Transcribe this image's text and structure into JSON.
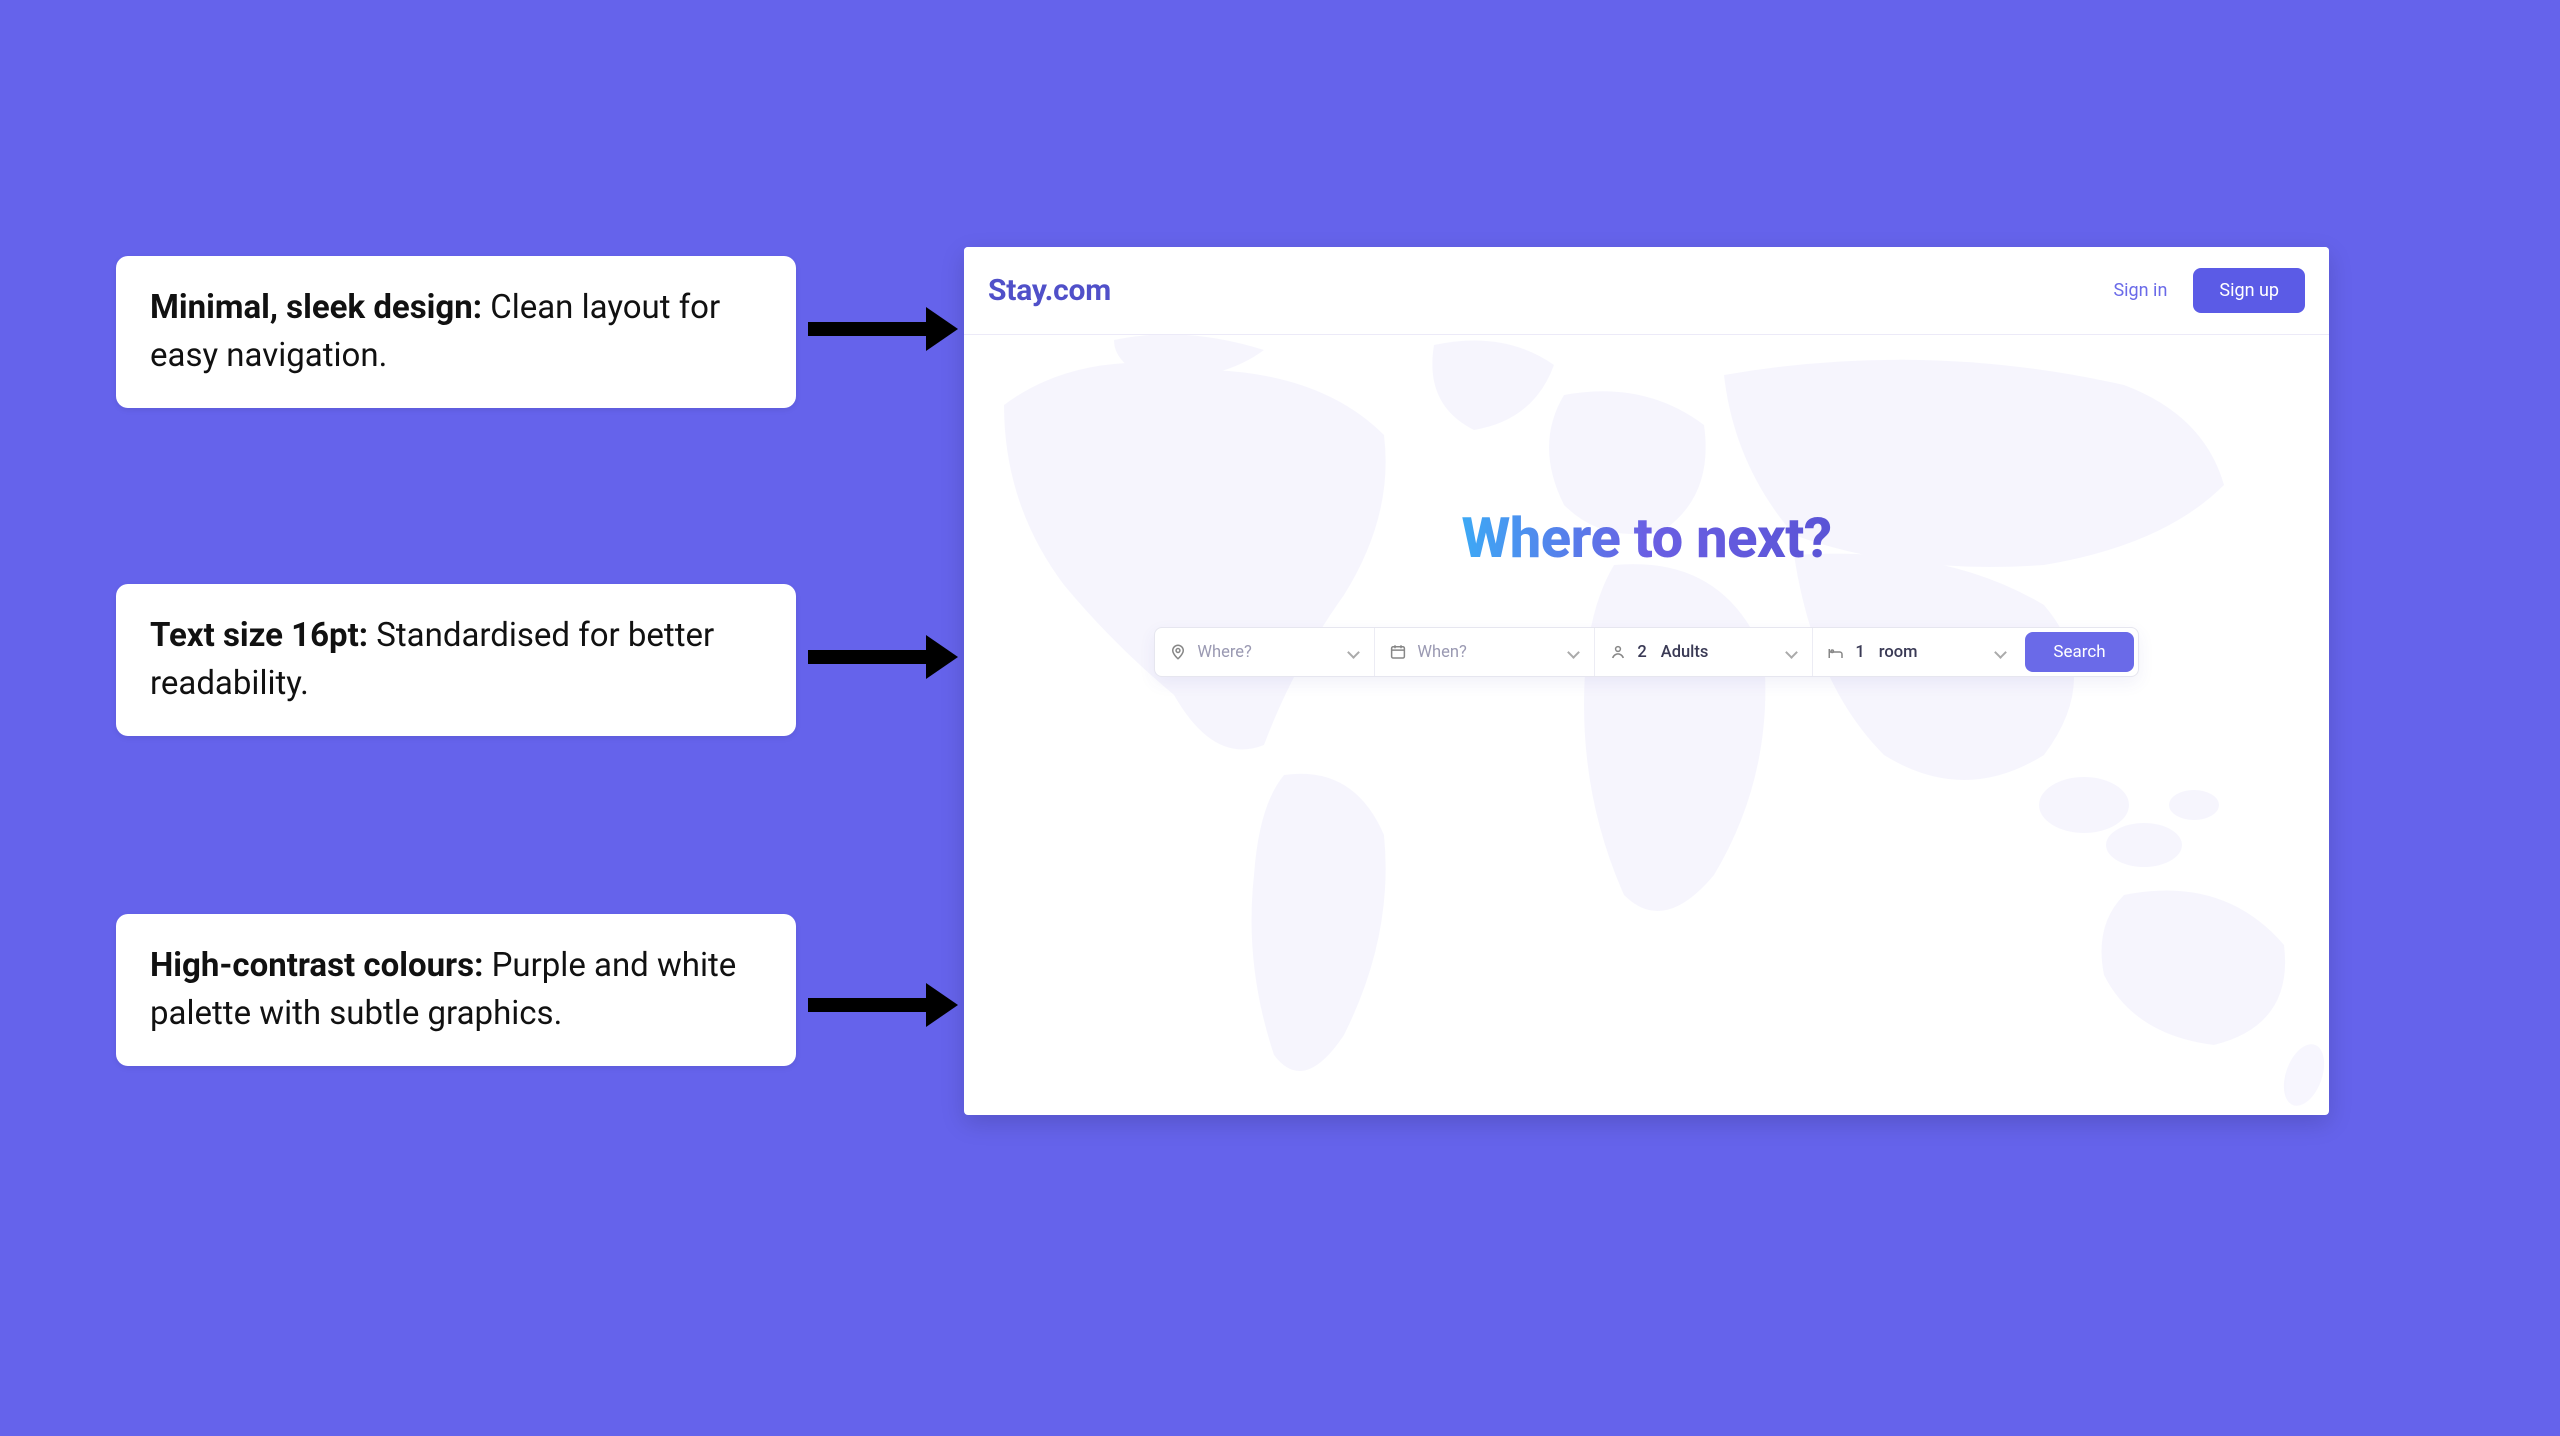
{
  "callouts": [
    {
      "bold": "Minimal, sleek design:",
      "rest": " Clean layout for easy navigation."
    },
    {
      "bold": "Text size 16pt:",
      "rest": " Standardised for better readability."
    },
    {
      "bold": "High-contrast colours:",
      "rest": " Purple and white palette with subtle graphics."
    }
  ],
  "site": {
    "logo": "Stay.com",
    "signin_label": "Sign in",
    "signup_label": "Sign up",
    "hero_title": "Where to next?",
    "search": {
      "where_placeholder": "Where?",
      "when_placeholder": "When?",
      "adults_count": "2",
      "adults_suffix": "Adults",
      "room_count": "1",
      "room_suffix": "room",
      "button_label": "Search"
    }
  },
  "colors": {
    "bg": "#6563eb",
    "accent": "#5b5be6"
  }
}
